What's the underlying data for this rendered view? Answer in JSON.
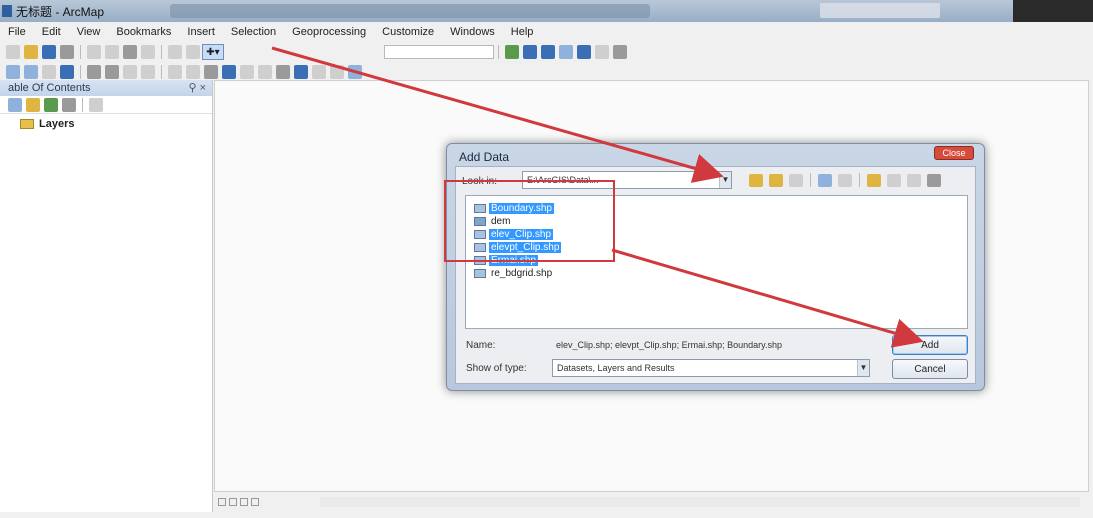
{
  "window": {
    "title": "无标题 - ArcMap"
  },
  "menubar": {
    "items": [
      "File",
      "Edit",
      "View",
      "Bookmarks",
      "Insert",
      "Selection",
      "Geoprocessing",
      "Customize",
      "Windows",
      "Help"
    ]
  },
  "toc": {
    "title": "able Of Contents",
    "pin_glyphs": "⚲ ×",
    "root_label": "Layers"
  },
  "dialog": {
    "title": "Add Data",
    "close_label": "Close",
    "look_in_label": "Look in:",
    "look_in_value": "E:\\ArcGIS\\Data\\...",
    "files": [
      {
        "name": "Boundary.shp",
        "selected": true
      },
      {
        "name": "dem",
        "selected": false
      },
      {
        "name": "elev_Clip.shp",
        "selected": true
      },
      {
        "name": "elevpt_Clip.shp",
        "selected": true
      },
      {
        "name": "Ermai.shp",
        "selected": true
      },
      {
        "name": "re_bdgrid.shp",
        "selected": false
      }
    ],
    "name_label": "Name:",
    "name_value": "elev_Clip.shp; elevpt_Clip.shp; Ermai.shp; Boundary.shp",
    "type_label": "Show of type:",
    "type_value": "Datasets, Layers and Results",
    "add_button": "Add",
    "cancel_button": "Cancel"
  },
  "colors": {
    "accent_selection": "#3399ff",
    "annotation_red": "#d0393e",
    "close_button": "#d64b3a"
  }
}
